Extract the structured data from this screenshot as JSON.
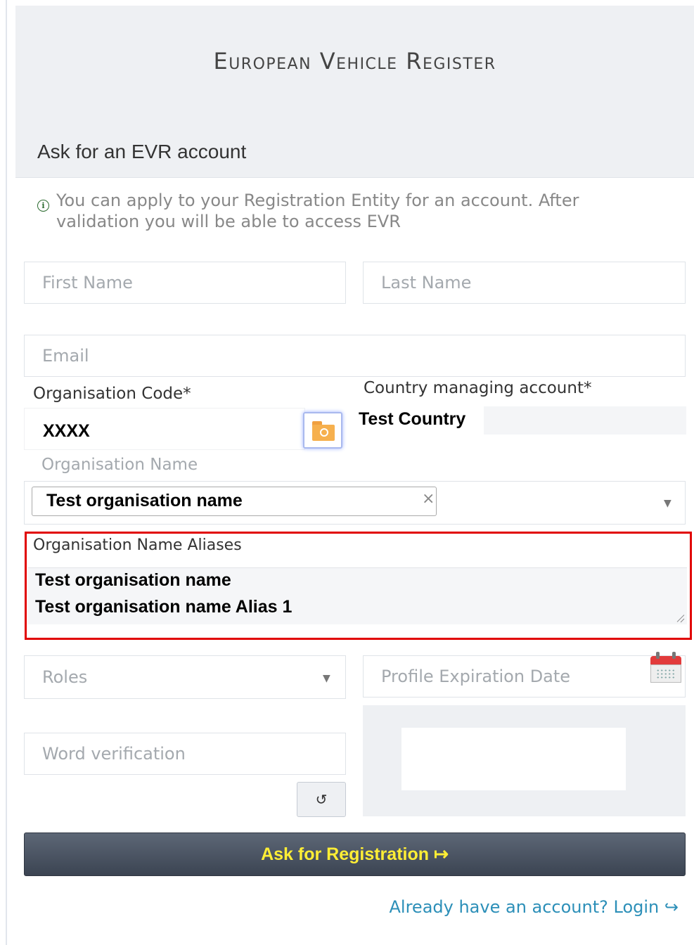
{
  "app": {
    "title": "European Vehicle Register"
  },
  "section": {
    "title": "Ask for an EVR account"
  },
  "info": {
    "icon": "info-circle-icon",
    "text": "You can apply to your Registration Entity for an account. After validation you will be able to access EVR"
  },
  "form": {
    "first_name": {
      "placeholder": "First Name",
      "value": ""
    },
    "last_name": {
      "placeholder": "Last Name",
      "value": ""
    },
    "email": {
      "placeholder": "Email",
      "value": ""
    },
    "org_code": {
      "label": "Organisation Code*",
      "value": "XXXX",
      "lookup_icon": "folder-search-icon"
    },
    "country": {
      "label": "Country managing account*",
      "value": "Test Country"
    },
    "org_name": {
      "label": "Organisation Name",
      "selected": "Test organisation name",
      "clear_glyph": "×"
    },
    "aliases": {
      "label": "Organisation Name Aliases",
      "lines": [
        "Test organisation name",
        "Test organisation name Alias 1"
      ],
      "highlight_color": "#e10000"
    },
    "roles": {
      "placeholder": "Roles"
    },
    "expiration": {
      "placeholder": "Profile Expiration Date",
      "icon": "calendar-icon"
    },
    "word_verification": {
      "placeholder": "Word verification",
      "refresh_glyph": "↺"
    }
  },
  "actions": {
    "submit_label": "Ask for Registration ↦",
    "login_link": "Already have an account? Login ↪"
  },
  "colors": {
    "submit_text": "#ffee35",
    "link": "#2c8fb8",
    "panel": "#eef0f3"
  }
}
